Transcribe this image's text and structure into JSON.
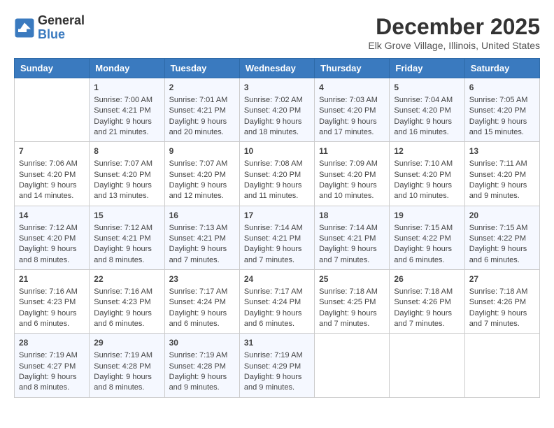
{
  "header": {
    "logo_line1": "General",
    "logo_line2": "Blue",
    "title": "December 2025",
    "subtitle": "Elk Grove Village, Illinois, United States"
  },
  "days_of_week": [
    "Sunday",
    "Monday",
    "Tuesday",
    "Wednesday",
    "Thursday",
    "Friday",
    "Saturday"
  ],
  "weeks": [
    [
      {
        "day": "",
        "content": ""
      },
      {
        "day": "1",
        "content": "Sunrise: 7:00 AM\nSunset: 4:21 PM\nDaylight: 9 hours\nand 21 minutes."
      },
      {
        "day": "2",
        "content": "Sunrise: 7:01 AM\nSunset: 4:21 PM\nDaylight: 9 hours\nand 20 minutes."
      },
      {
        "day": "3",
        "content": "Sunrise: 7:02 AM\nSunset: 4:20 PM\nDaylight: 9 hours\nand 18 minutes."
      },
      {
        "day": "4",
        "content": "Sunrise: 7:03 AM\nSunset: 4:20 PM\nDaylight: 9 hours\nand 17 minutes."
      },
      {
        "day": "5",
        "content": "Sunrise: 7:04 AM\nSunset: 4:20 PM\nDaylight: 9 hours\nand 16 minutes."
      },
      {
        "day": "6",
        "content": "Sunrise: 7:05 AM\nSunset: 4:20 PM\nDaylight: 9 hours\nand 15 minutes."
      }
    ],
    [
      {
        "day": "7",
        "content": "Sunrise: 7:06 AM\nSunset: 4:20 PM\nDaylight: 9 hours\nand 14 minutes."
      },
      {
        "day": "8",
        "content": "Sunrise: 7:07 AM\nSunset: 4:20 PM\nDaylight: 9 hours\nand 13 minutes."
      },
      {
        "day": "9",
        "content": "Sunrise: 7:07 AM\nSunset: 4:20 PM\nDaylight: 9 hours\nand 12 minutes."
      },
      {
        "day": "10",
        "content": "Sunrise: 7:08 AM\nSunset: 4:20 PM\nDaylight: 9 hours\nand 11 minutes."
      },
      {
        "day": "11",
        "content": "Sunrise: 7:09 AM\nSunset: 4:20 PM\nDaylight: 9 hours\nand 10 minutes."
      },
      {
        "day": "12",
        "content": "Sunrise: 7:10 AM\nSunset: 4:20 PM\nDaylight: 9 hours\nand 10 minutes."
      },
      {
        "day": "13",
        "content": "Sunrise: 7:11 AM\nSunset: 4:20 PM\nDaylight: 9 hours\nand 9 minutes."
      }
    ],
    [
      {
        "day": "14",
        "content": "Sunrise: 7:12 AM\nSunset: 4:20 PM\nDaylight: 9 hours\nand 8 minutes."
      },
      {
        "day": "15",
        "content": "Sunrise: 7:12 AM\nSunset: 4:21 PM\nDaylight: 9 hours\nand 8 minutes."
      },
      {
        "day": "16",
        "content": "Sunrise: 7:13 AM\nSunset: 4:21 PM\nDaylight: 9 hours\nand 7 minutes."
      },
      {
        "day": "17",
        "content": "Sunrise: 7:14 AM\nSunset: 4:21 PM\nDaylight: 9 hours\nand 7 minutes."
      },
      {
        "day": "18",
        "content": "Sunrise: 7:14 AM\nSunset: 4:21 PM\nDaylight: 9 hours\nand 7 minutes."
      },
      {
        "day": "19",
        "content": "Sunrise: 7:15 AM\nSunset: 4:22 PM\nDaylight: 9 hours\nand 6 minutes."
      },
      {
        "day": "20",
        "content": "Sunrise: 7:15 AM\nSunset: 4:22 PM\nDaylight: 9 hours\nand 6 minutes."
      }
    ],
    [
      {
        "day": "21",
        "content": "Sunrise: 7:16 AM\nSunset: 4:23 PM\nDaylight: 9 hours\nand 6 minutes."
      },
      {
        "day": "22",
        "content": "Sunrise: 7:16 AM\nSunset: 4:23 PM\nDaylight: 9 hours\nand 6 minutes."
      },
      {
        "day": "23",
        "content": "Sunrise: 7:17 AM\nSunset: 4:24 PM\nDaylight: 9 hours\nand 6 minutes."
      },
      {
        "day": "24",
        "content": "Sunrise: 7:17 AM\nSunset: 4:24 PM\nDaylight: 9 hours\nand 6 minutes."
      },
      {
        "day": "25",
        "content": "Sunrise: 7:18 AM\nSunset: 4:25 PM\nDaylight: 9 hours\nand 7 minutes."
      },
      {
        "day": "26",
        "content": "Sunrise: 7:18 AM\nSunset: 4:26 PM\nDaylight: 9 hours\nand 7 minutes."
      },
      {
        "day": "27",
        "content": "Sunrise: 7:18 AM\nSunset: 4:26 PM\nDaylight: 9 hours\nand 7 minutes."
      }
    ],
    [
      {
        "day": "28",
        "content": "Sunrise: 7:19 AM\nSunset: 4:27 PM\nDaylight: 9 hours\nand 8 minutes."
      },
      {
        "day": "29",
        "content": "Sunrise: 7:19 AM\nSunset: 4:28 PM\nDaylight: 9 hours\nand 8 minutes."
      },
      {
        "day": "30",
        "content": "Sunrise: 7:19 AM\nSunset: 4:28 PM\nDaylight: 9 hours\nand 9 minutes."
      },
      {
        "day": "31",
        "content": "Sunrise: 7:19 AM\nSunset: 4:29 PM\nDaylight: 9 hours\nand 9 minutes."
      },
      {
        "day": "",
        "content": ""
      },
      {
        "day": "",
        "content": ""
      },
      {
        "day": "",
        "content": ""
      }
    ]
  ]
}
